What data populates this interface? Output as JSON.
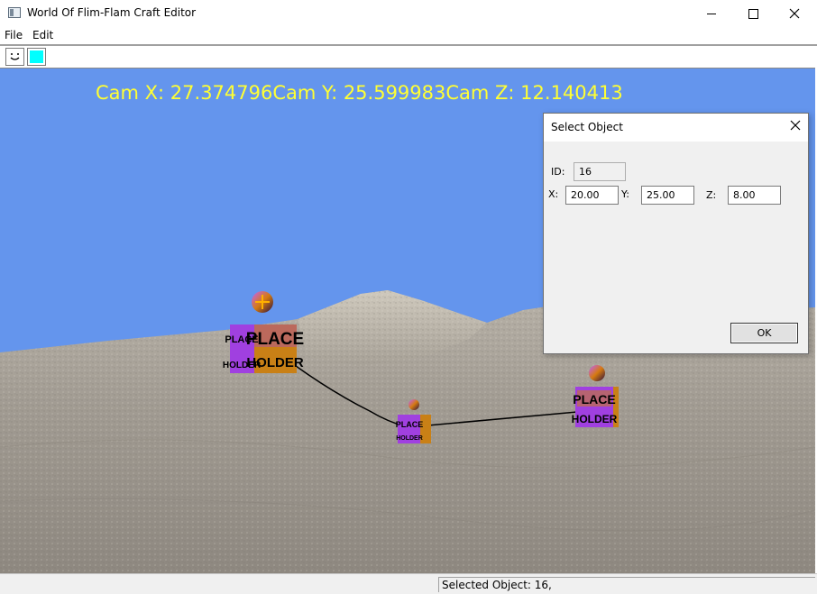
{
  "window": {
    "title": "World Of Flim-Flam Craft Editor",
    "controls": {
      "minimize": "minimize-icon",
      "maximize": "maximize-icon",
      "close": "close-icon"
    }
  },
  "menu": {
    "items": [
      {
        "label": "File"
      },
      {
        "label": "Edit"
      }
    ]
  },
  "toolbar": {
    "buttons": [
      {
        "icon": "smiley-icon",
        "glyph": "⌣"
      },
      {
        "icon": "color-swatch-icon",
        "color": "#00ffff"
      }
    ]
  },
  "viewport": {
    "camera_readout": "Cam X: 27.374796Cam Y: 25.599983Cam Z: 12.140413",
    "sky_color": "#6495ed",
    "text_color": "#ffff33",
    "objects": [
      {
        "label_line1": "PLACE",
        "label_line2": "HOLDER"
      },
      {
        "label_line1": "PLACE",
        "label_line2": "HOLDER"
      },
      {
        "label_line1": "PLACE",
        "label_line2": "HOLDER"
      }
    ]
  },
  "dialog": {
    "title": "Select Object",
    "id_label": "ID:",
    "id_value": "16",
    "x_label": "X:",
    "x_value": "20.00",
    "y_label": "Y:",
    "y_value": "25.00",
    "z_label": "Z:",
    "z_value": "8.00",
    "ok_label": "OK"
  },
  "status": {
    "text": "Selected Object: 16,"
  }
}
